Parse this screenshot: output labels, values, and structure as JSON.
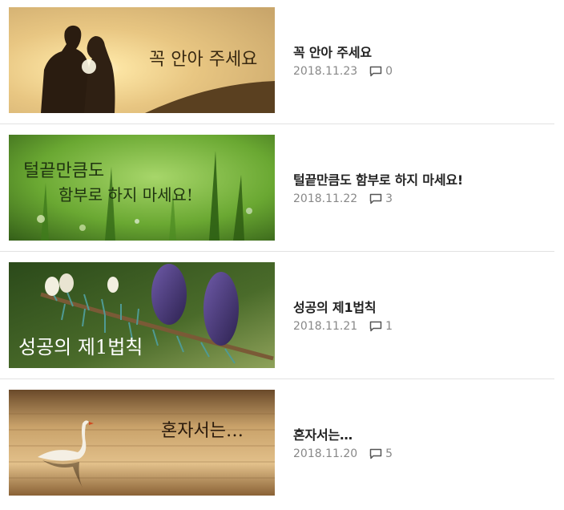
{
  "posts": [
    {
      "title": "꼭 안아 주세요",
      "date": "2018.11.23",
      "comments": "0",
      "image_caption": "꼭 안아 주세요",
      "thumbnail": "couple-sunset-image"
    },
    {
      "title": "털끝만큼도 함부로 하지 마세요!",
      "date": "2018.11.22",
      "comments": "3",
      "image_caption_line1": "털끝만큼도",
      "image_caption_line2": "함부로 하지 마세요!",
      "thumbnail": "green-grass-image"
    },
    {
      "title": "성공의 제1법칙",
      "date": "2018.11.21",
      "comments": "1",
      "image_caption": "성공의 제1법칙",
      "thumbnail": "pine-cones-image"
    },
    {
      "title": "혼자서는…",
      "date": "2018.11.20",
      "comments": "5",
      "image_caption": "혼자서는…",
      "thumbnail": "swan-lake-image"
    }
  ],
  "icons": {
    "comment": "comment-icon"
  },
  "colors": {
    "title": "#222222",
    "meta": "#888888",
    "divider": "#e2e2e2"
  }
}
